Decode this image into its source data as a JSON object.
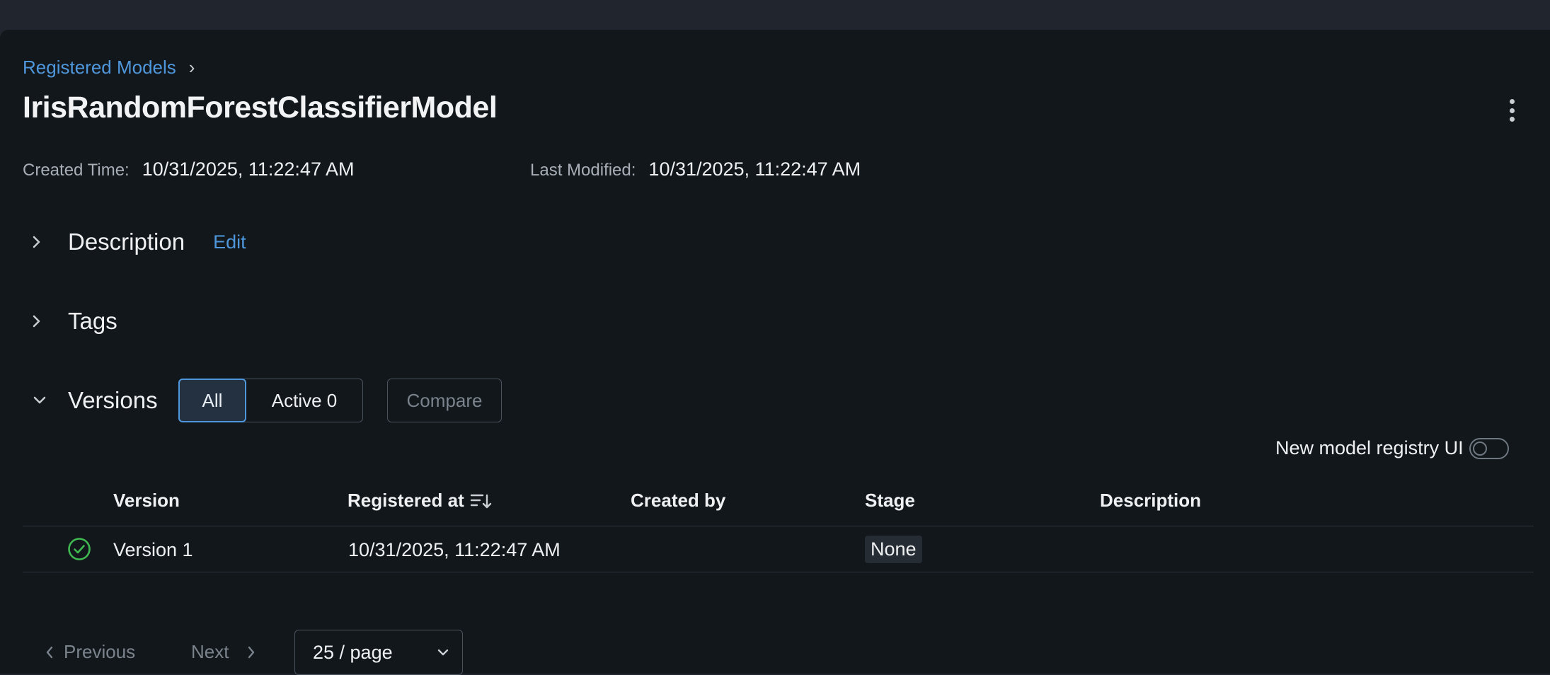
{
  "breadcrumb": {
    "registered_models": "Registered Models",
    "separator": "›"
  },
  "model": {
    "name": "IrisRandomForestClassifierModel"
  },
  "meta": {
    "created_label": "Created Time:",
    "created_value": "10/31/2025, 11:22:47 AM",
    "modified_label": "Last Modified:",
    "modified_value": "10/31/2025, 11:22:47 AM"
  },
  "sections": {
    "description": {
      "title": "Description",
      "edit_label": "Edit",
      "expanded": false
    },
    "tags": {
      "title": "Tags",
      "expanded": false
    },
    "versions": {
      "title": "Versions",
      "expanded": true
    }
  },
  "filters": {
    "all_label": "All",
    "active_label": "Active 0",
    "selected": "All"
  },
  "compare_label": "Compare",
  "registry_toggle": {
    "label": "New model registry UI",
    "on": false
  },
  "table": {
    "columns": [
      "Version",
      "Registered at",
      "Created by",
      "Stage",
      "Description"
    ],
    "rows": [
      {
        "status": "ready",
        "version": "Version 1",
        "registered_at": "10/31/2025, 11:22:47 AM",
        "created_by": "",
        "stage": "None",
        "description": ""
      }
    ]
  },
  "pagination": {
    "previous": "Previous",
    "next": "Next",
    "page_size": "25 / page"
  },
  "colors": {
    "accent": "#4f97dc",
    "success": "#3fb950",
    "background": "#12171c"
  }
}
